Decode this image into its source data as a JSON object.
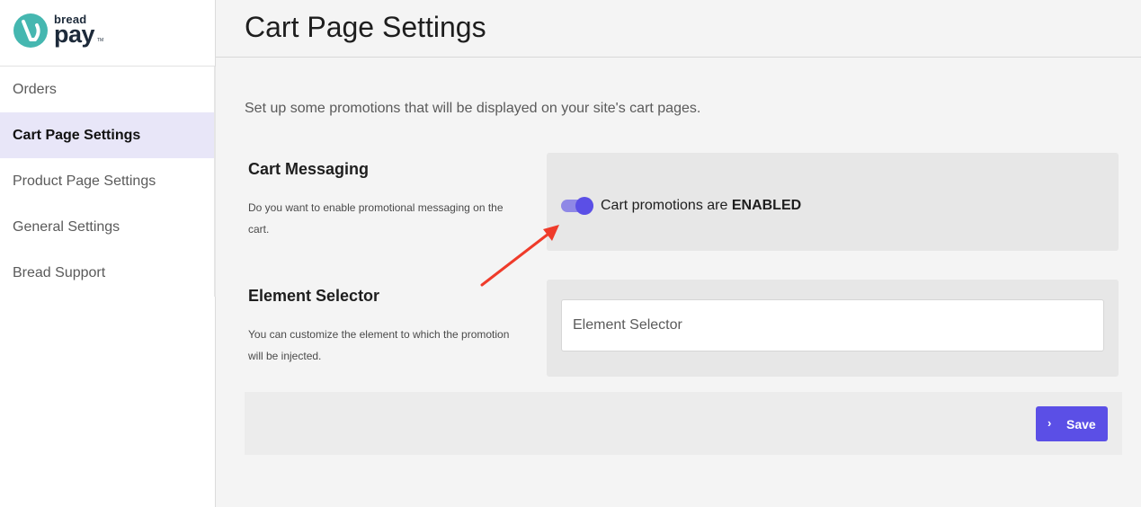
{
  "brand": {
    "name_top": "bread",
    "name_bottom": "pay",
    "tm": "TM",
    "mark_color": "#45b7b0"
  },
  "sidebar": {
    "items": [
      {
        "label": "Orders",
        "active": false
      },
      {
        "label": "Cart Page Settings",
        "active": true
      },
      {
        "label": "Product Page Settings",
        "active": false
      },
      {
        "label": "General Settings",
        "active": false
      },
      {
        "label": "Bread Support",
        "active": false
      }
    ]
  },
  "header": {
    "title": "Cart Page Settings"
  },
  "intro": "Set up some promotions that will be displayed on your site's cart pages.",
  "cart_messaging": {
    "title": "Cart Messaging",
    "description": "Do you want to enable promotional messaging on the cart.",
    "toggle_on": true,
    "status_prefix": "Cart promotions are ",
    "status_value": "ENABLED"
  },
  "element_selector": {
    "title": "Element Selector",
    "description": "You can customize the element to which the promotion will be injected.",
    "placeholder": "Element Selector",
    "value": ""
  },
  "footer": {
    "save_label": "Save"
  },
  "colors": {
    "accent": "#5b4fe6",
    "active_nav_bg": "#e8e6f8",
    "annotation_arrow": "#ef3b2a"
  }
}
